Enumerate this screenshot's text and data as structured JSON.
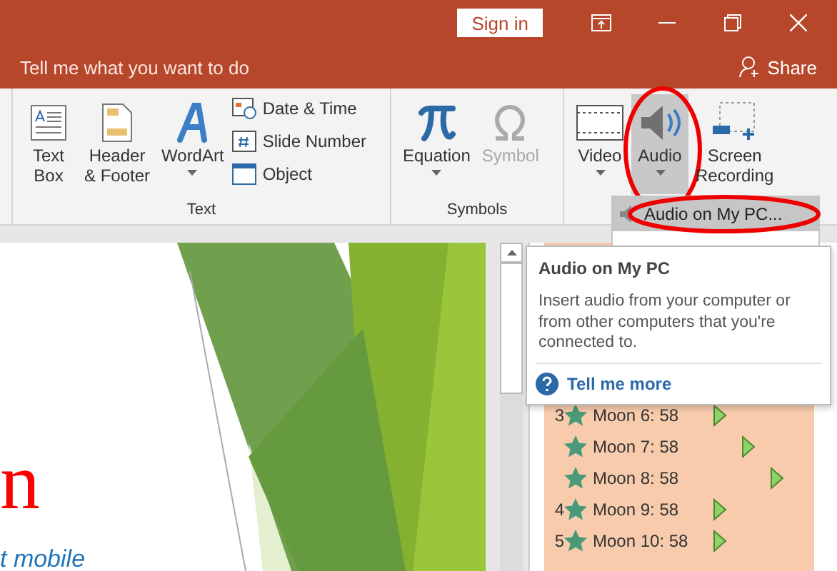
{
  "title_bar": {
    "sign_in": "Sign in"
  },
  "tell_me": {
    "placeholder": "Tell me what you want to do",
    "share": "Share"
  },
  "ribbon": {
    "groups": [
      {
        "label": "Text",
        "buttons": [
          {
            "kind": "textbox",
            "label": "Text\nBox",
            "dropdown": false,
            "disabled": false,
            "selected": false,
            "circled": false
          },
          {
            "kind": "headerfooter",
            "label": "Header\n& Footer",
            "dropdown": false,
            "disabled": false,
            "selected": false,
            "circled": false
          },
          {
            "kind": "wordart",
            "label": "WordArt",
            "dropdown": true,
            "disabled": false,
            "selected": false,
            "circled": false
          }
        ],
        "small_buttons": [
          {
            "kind": "datetime",
            "label": "Date & Time"
          },
          {
            "kind": "slidenumber",
            "label": "Slide Number"
          },
          {
            "kind": "object",
            "label": "Object"
          }
        ]
      },
      {
        "label": "Symbols",
        "buttons": [
          {
            "kind": "equation",
            "label": "Equation",
            "dropdown": true,
            "disabled": false,
            "selected": false,
            "circled": false
          },
          {
            "kind": "symbol",
            "label": "Symbol",
            "dropdown": false,
            "disabled": true,
            "selected": false,
            "circled": false
          }
        ]
      },
      {
        "buttons": [
          {
            "kind": "video",
            "label": "Video",
            "dropdown": true,
            "disabled": false,
            "selected": false,
            "circled": false
          },
          {
            "kind": "audio",
            "label": "Audio",
            "dropdown": true,
            "disabled": false,
            "selected": true,
            "circled": true
          },
          {
            "kind": "screenrec",
            "label": "Screen\nRecording",
            "dropdown": false,
            "disabled": false,
            "selected": false,
            "circled": false
          }
        ]
      }
    ]
  },
  "audio_menu": {
    "items": [
      {
        "label": "Audio on My PC...",
        "selected": true,
        "circled": true
      }
    ]
  },
  "tooltip": {
    "title": "Audio on My PC",
    "body": "Insert audio from your computer or from other computers that you're connected to.",
    "link": "Tell me more"
  },
  "slide": {
    "title_fragment": "n",
    "subtitle_fragment": "t mobile"
  },
  "animation_pane": {
    "rows": [
      {
        "number": "3",
        "label": "Moon 6: 58",
        "kind": "on_click"
      },
      {
        "number": "",
        "label": "Moon 7: 58",
        "kind": "after_previous"
      },
      {
        "number": "",
        "label": "Moon 8: 58",
        "kind": "after_previous"
      },
      {
        "number": "4",
        "label": "Moon 9: 58",
        "kind": "on_click"
      },
      {
        "number": "5",
        "label": "Moon 10: 58",
        "kind": "on_click"
      }
    ]
  }
}
